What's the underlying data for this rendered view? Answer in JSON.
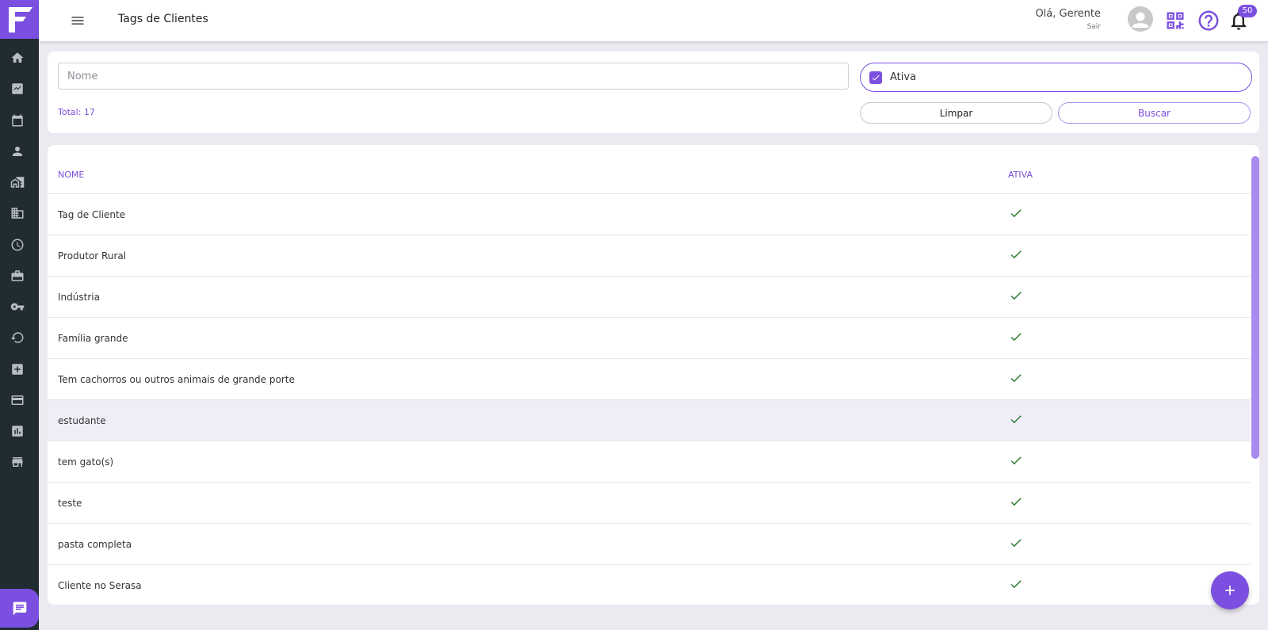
{
  "header": {
    "title": "Tags de Clientes",
    "greeting": "Olá, Gerente",
    "logout": "Sair",
    "notification_count": "50"
  },
  "sidebar": {
    "items": [
      {
        "icon": "home-icon"
      },
      {
        "icon": "chart-line-icon"
      },
      {
        "icon": "calendar-icon"
      },
      {
        "icon": "person-icon"
      },
      {
        "icon": "real-estate-icon"
      },
      {
        "icon": "building-icon"
      },
      {
        "icon": "clock-icon"
      },
      {
        "icon": "briefcase-icon"
      },
      {
        "icon": "key-icon"
      },
      {
        "icon": "restore-icon"
      },
      {
        "icon": "medical-kit-icon"
      },
      {
        "icon": "credit-card-icon"
      },
      {
        "icon": "bar-chart-icon"
      },
      {
        "icon": "store-icon"
      }
    ]
  },
  "filters": {
    "name_placeholder": "Nome",
    "active_label": "Ativa",
    "active_checked": true,
    "total": "Total: 17",
    "clear_label": "Limpar",
    "search_label": "Buscar"
  },
  "table": {
    "columns": [
      "NOME",
      "ATIVA"
    ],
    "rows": [
      {
        "name": "Tag de Cliente",
        "active": true
      },
      {
        "name": "Produtor Rural",
        "active": true
      },
      {
        "name": "Indústria",
        "active": true
      },
      {
        "name": "Família grande",
        "active": true
      },
      {
        "name": "Tem cachorros ou outros animais de grande porte",
        "active": true
      },
      {
        "name": "estudante",
        "active": true
      },
      {
        "name": "tem gato(s)",
        "active": true
      },
      {
        "name": "teste",
        "active": true
      },
      {
        "name": "pasta completa",
        "active": true
      },
      {
        "name": "Cliente no Serasa",
        "active": true
      }
    ]
  },
  "colors": {
    "accent": "#7B4FE0",
    "sidebar_bg": "#212B32",
    "check": "#2E7D32"
  }
}
